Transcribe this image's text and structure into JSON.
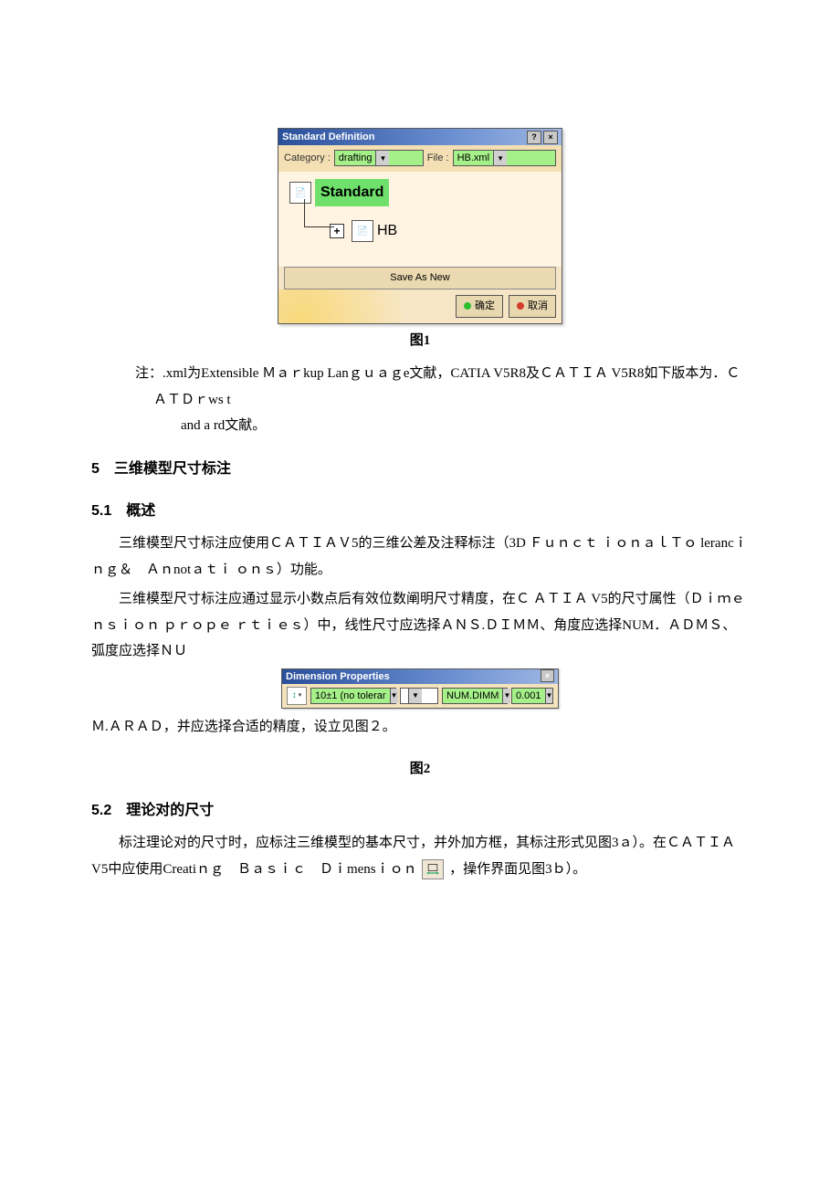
{
  "figure1": {
    "dialog": {
      "title": "Standard Definition",
      "help_btn": "?",
      "close_btn": "×",
      "category_label": "Category :",
      "category_value": "drafting",
      "file_label": "File :",
      "file_value": "HB.xml",
      "tree_root": "Standard",
      "tree_child": "HB",
      "plus": "+",
      "save_as_new": "Save As New",
      "ok": "确定",
      "cancel": "取消"
    },
    "caption": "图1"
  },
  "note": {
    "line1": "注：.xml为Extensible Ｍａｒkup Lanｇｕａｇe文献，CATIA V5R8及ＣＡＴＩＡ V5R8如下版本为．ＣＡＴＤｒws t",
    "line2": "and a rd文献。"
  },
  "sec5": {
    "title": "5　三维模型尺寸标注"
  },
  "sec5_1": {
    "title": "5.1　概述",
    "p1": "三维模型尺寸标注应使用ＣＡＴＩＡＶ5的三维公差及注释标注（3D Ｆｕｎｃｔ ｉｏｎａｌＴｏ lerancｉｎｇ＆　Ａｎnotａｔｉ ｏｎｓ）功能。",
    "p2": "三维模型尺寸标注应通过显示小数点后有效位数阐明尺寸精度，在Ｃ ＡＴＩＡ V5的尺寸属性（Ｄｉｍｅｎｓｉｏｎ ｐｒｏｐｅ ｒｔｉｅｓ）中，线性尺寸应选择ＡＮＳ.ＤＩＭＭ、角度应选择NUM．ＡＤＭＳ、弧度应选择ＮＵ",
    "p3_prefix": "Ｍ.ＡＲＡＤ，并应选择合适的精度，设立见图２。"
  },
  "figure2": {
    "dialog": {
      "title": "Dimension Properties",
      "close_btn": "×",
      "tolerance_value": "10±1 (no tolerar",
      "blank_value": "",
      "format_value": "NUM.DIMM",
      "precision_value": "0.001"
    },
    "caption": "图2"
  },
  "sec5_2": {
    "title": "5.2　理论对的尺寸",
    "p1_a": "标注理论对的尺寸时，应标注三维模型的基本尺寸，并外加方框，其标注形式见图3ａ）。在ＣＡＴＩＡ V5中应使用Creatiｎｇ　Ｂａｓｉｃ　Ｄｉmensｉｏｎ",
    "p1_b": "，操作界面见图3ｂ）。"
  }
}
